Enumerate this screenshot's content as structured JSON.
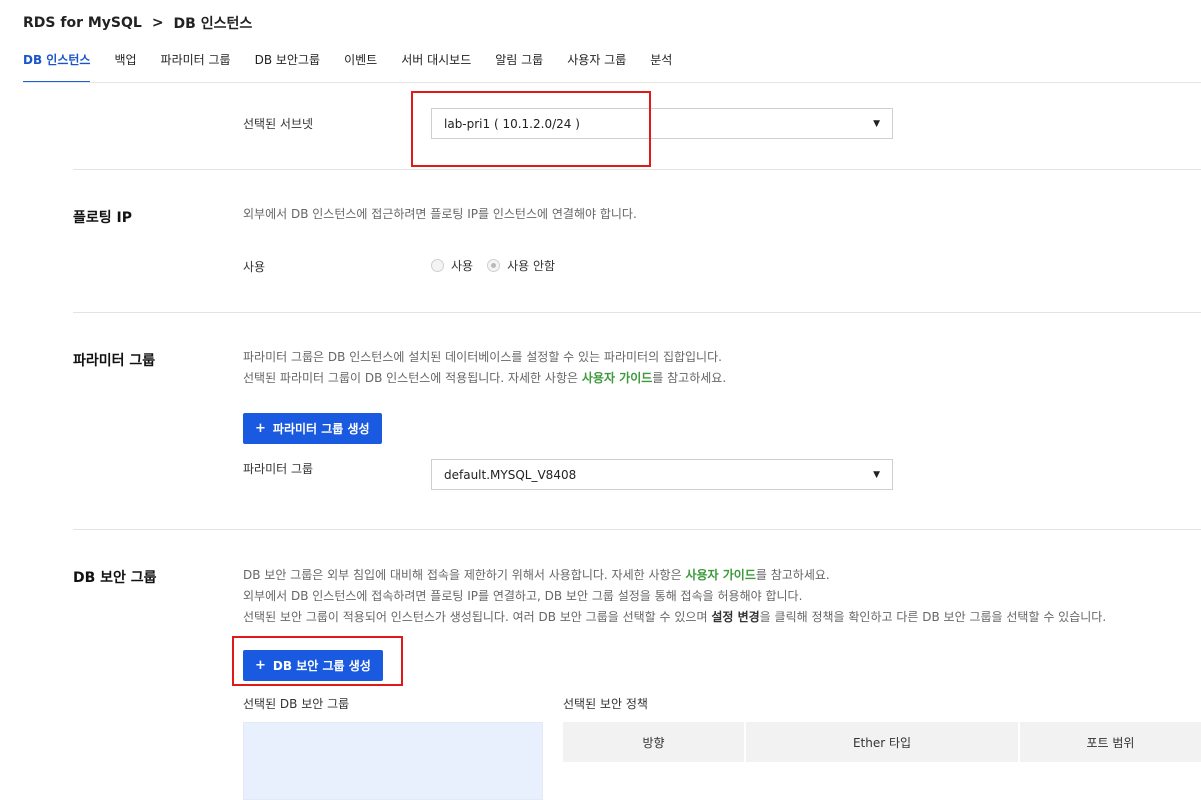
{
  "breadcrumb": {
    "root": "RDS for MySQL",
    "separator": ">",
    "current": "DB 인스턴스"
  },
  "tabs": [
    {
      "label": "DB 인스턴스"
    },
    {
      "label": "백업"
    },
    {
      "label": "파라미터 그룹"
    },
    {
      "label": "DB 보안그룹"
    },
    {
      "label": "이벤트"
    },
    {
      "label": "서버 대시보드"
    },
    {
      "label": "알림 그룹"
    },
    {
      "label": "사용자 그룹"
    },
    {
      "label": "분석"
    }
  ],
  "subnet": {
    "label": "선택된 서브넷",
    "value": "lab-pri1 ( 10.1.2.0/24 )"
  },
  "floating_ip": {
    "title": "플로팅 IP",
    "desc": "외부에서 DB 인스턴스에 접근하려면 플로팅 IP를 인스턴스에 연결해야 합니다.",
    "use_label": "사용",
    "options": [
      "사용",
      "사용 안함"
    ],
    "selected": "사용 안함"
  },
  "parameter_group": {
    "title": "파라미터 그룹",
    "desc_line1": "파라미터 그룹은 DB 인스턴스에 설치된 데이터베이스를 설정할 수 있는 파라미터의 집합입니다.",
    "desc_line2_before": "선택된 파라미터 그룹이 DB 인스턴스에 적용됩니다. 자세한 사항은 ",
    "desc_line2_link": "사용자 가이드",
    "desc_line2_after": "를 참고하세요.",
    "create_button": "파라미터 그룹 생성",
    "field_label": "파라미터 그룹",
    "value": "default.MYSQL_V8408"
  },
  "security_group": {
    "title": "DB 보안 그룹",
    "desc_line1_before": "DB 보안 그룹은 외부 침입에 대비해 접속을 제한하기 위해서 사용합니다. 자세한 사항은 ",
    "desc_line1_link": "사용자 가이드",
    "desc_line1_after": "를 참고하세요.",
    "desc_line2": "외부에서 DB 인스턴스에 접속하려면 플로팅 IP를 연결하고, DB 보안 그룹 설정을 통해 접속을 허용해야 합니다.",
    "desc_line3_before": "선택된 보안 그룹이 적용되어 인스턴스가 생성됩니다. 여러 DB 보안 그룹을 선택할 수 있으며 ",
    "desc_line3_bold": "설정 변경",
    "desc_line3_after": "을 클릭해 정책을 확인하고 다른 DB 보안 그룹을 선택할 수 있습니다.",
    "create_button": "DB 보안 그룹 생성",
    "selected_group_label": "선택된 DB 보안 그룹",
    "selected_policy_label": "선택된 보안 정책",
    "policy_columns": [
      "방향",
      "Ether 타입",
      "포트 범위"
    ]
  },
  "colors": {
    "primary": "#1a5ae0",
    "link": "#3c9a3a",
    "highlight": "#e01a1a",
    "active_tab": "#1a55c7"
  }
}
